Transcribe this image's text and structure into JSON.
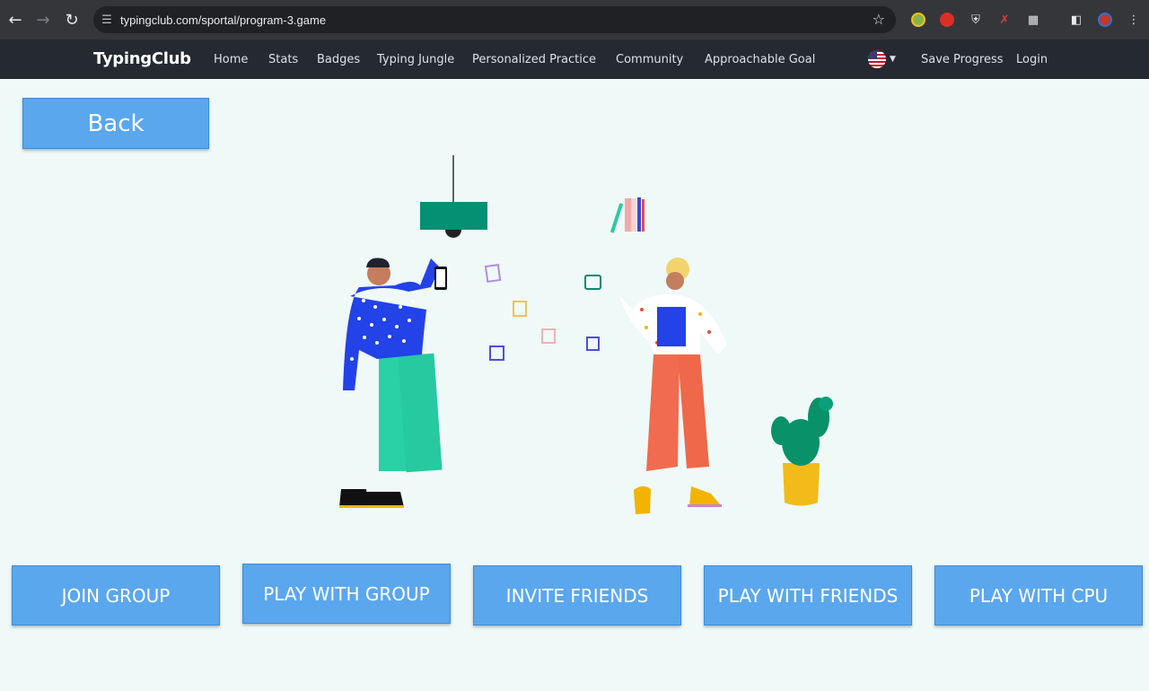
{
  "browser": {
    "url": "typingclub.com/sportal/program-3.game"
  },
  "site": {
    "logo": "TypingClub",
    "menu": [
      "Home",
      "Stats",
      "Badges",
      "Typing Jungle",
      "Personalized Practice",
      "Community",
      "Approachable Goal"
    ],
    "save_progress": "Save Progress",
    "login": "Login"
  },
  "page": {
    "back_label": "Back",
    "actions": [
      "JOIN GROUP",
      "PLAY WITH GROUP",
      "INVITE FRIENDS",
      "PLAY WITH FRIENDS",
      "PLAY WITH CPU"
    ]
  },
  "icons": {
    "back_arrow": "arrow-left-icon",
    "forward_arrow": "arrow-right-icon",
    "reload": "reload-icon",
    "site_settings": "tune-icon",
    "bookmark": "star-icon",
    "language": "us-flag-icon"
  },
  "colors": {
    "page_bg": "#eef9f8",
    "nav_bg": "#252a31",
    "button_bg": "#5aa7ee"
  }
}
